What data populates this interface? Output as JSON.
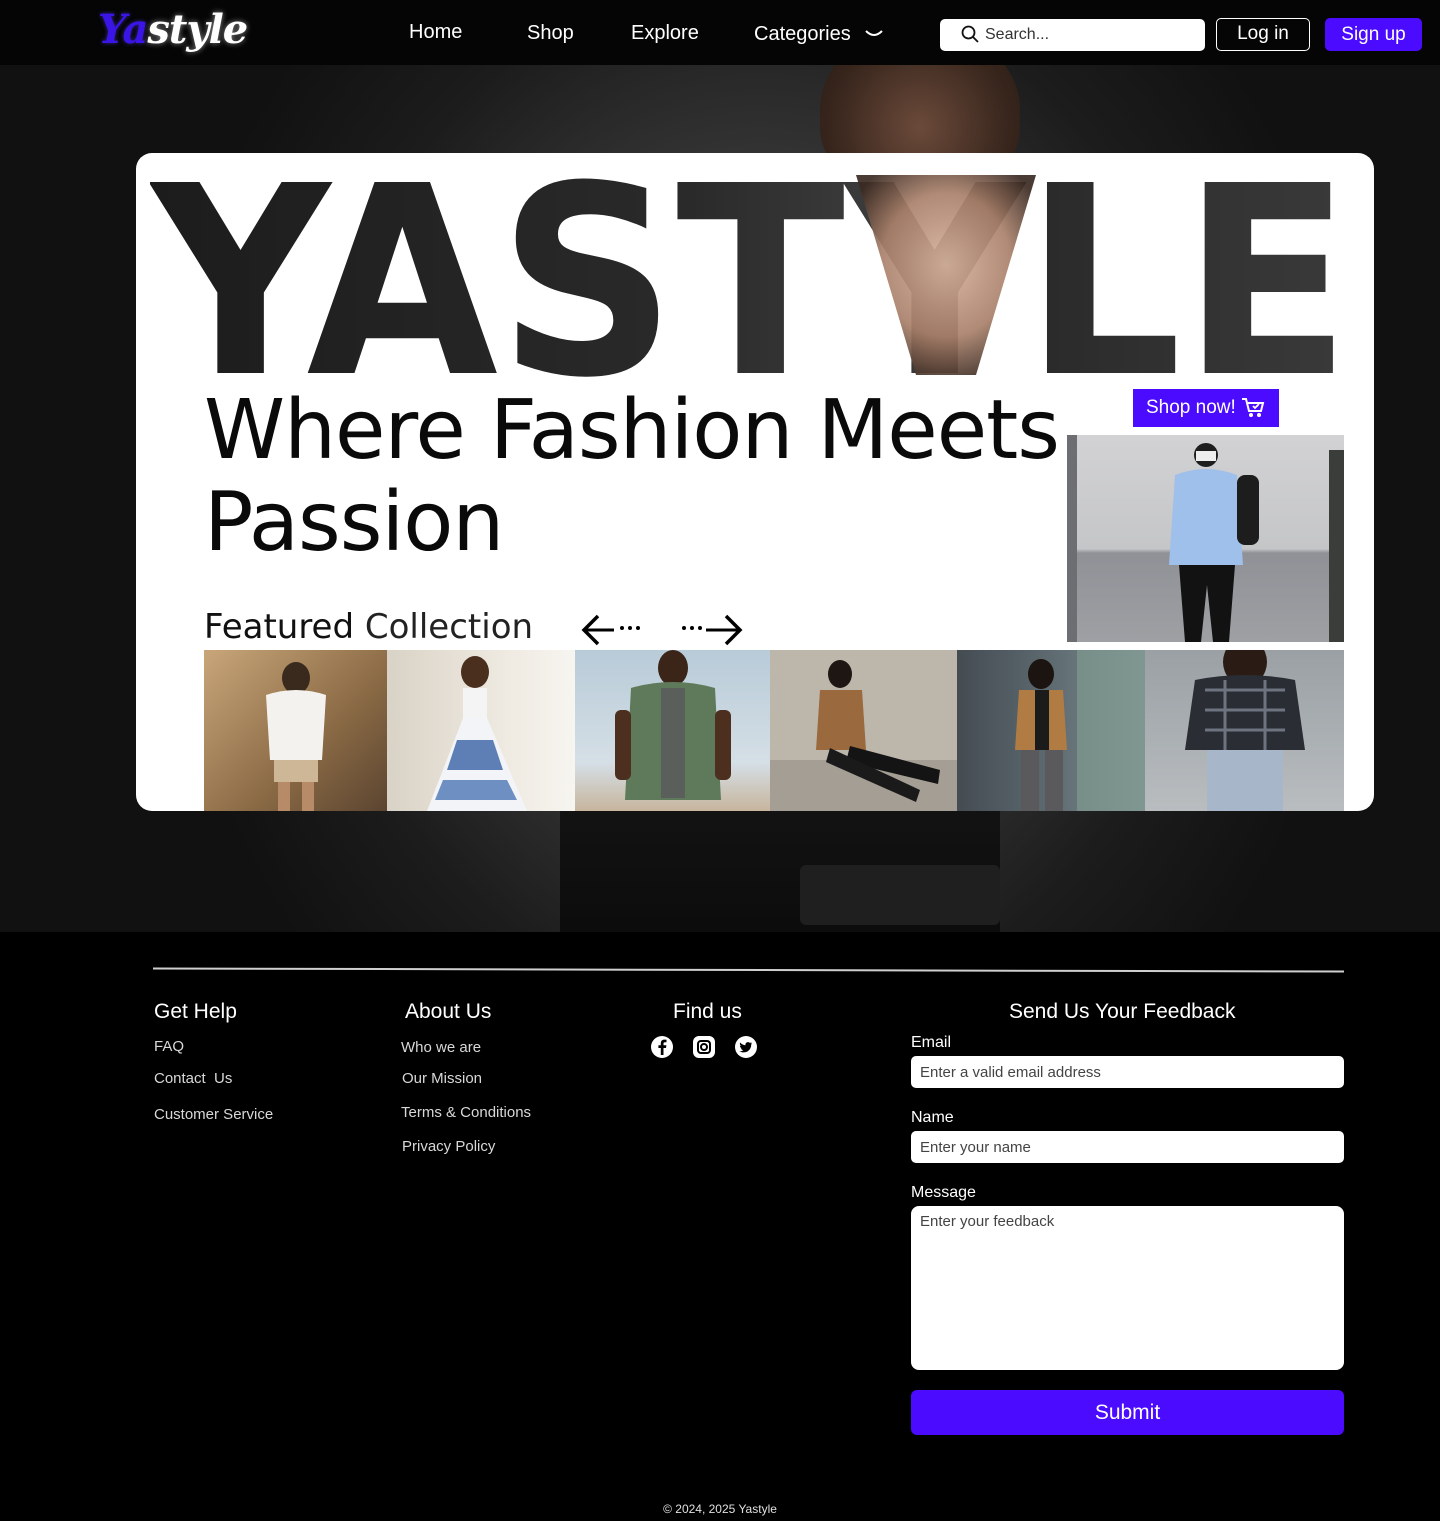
{
  "nav": {
    "logo_ya": "Ya",
    "logo_rest": "style",
    "links": [
      "Home",
      "Shop",
      "Explore",
      "Categories"
    ],
    "search_placeholder": "Search...",
    "login": "Log in",
    "signup": "Sign up",
    "accent_color": "#4b0bff"
  },
  "hero": {
    "big_word": "YASTYLE",
    "tagline": "Where Fashion Meets Passion",
    "shop_now": "Shop now!",
    "featured_a": "Featured",
    "featured_b": "Collection",
    "thumbnails": [
      "woman-white-blouse-shorts",
      "woman-blue-white-dress",
      "man-green-shirt",
      "man-brown-jacket-seated",
      "man-tan-jacket-window",
      "woman-plaid-shirt-denim"
    ]
  },
  "footer": {
    "get_help": {
      "title": "Get Help",
      "links": [
        "FAQ",
        "Contact  Us",
        "Customer Service"
      ]
    },
    "about": {
      "title": "About Us",
      "links": [
        "Who we are",
        "Our Mission",
        "Terms & Conditions",
        "Privacy Policy"
      ]
    },
    "find_us": {
      "title": "Find us",
      "icons": [
        "facebook-icon",
        "instagram-icon",
        "twitter-icon"
      ]
    },
    "feedback": {
      "title": "Send Us Your Feedback",
      "email_label": "Email",
      "email_placeholder": "Enter a valid email address",
      "name_label": "Name",
      "name_placeholder": "Enter your name",
      "message_label": "Message",
      "message_placeholder": "Enter your feedback",
      "submit": "Submit"
    },
    "copyright": "© 2024, 2025 Yastyle"
  }
}
